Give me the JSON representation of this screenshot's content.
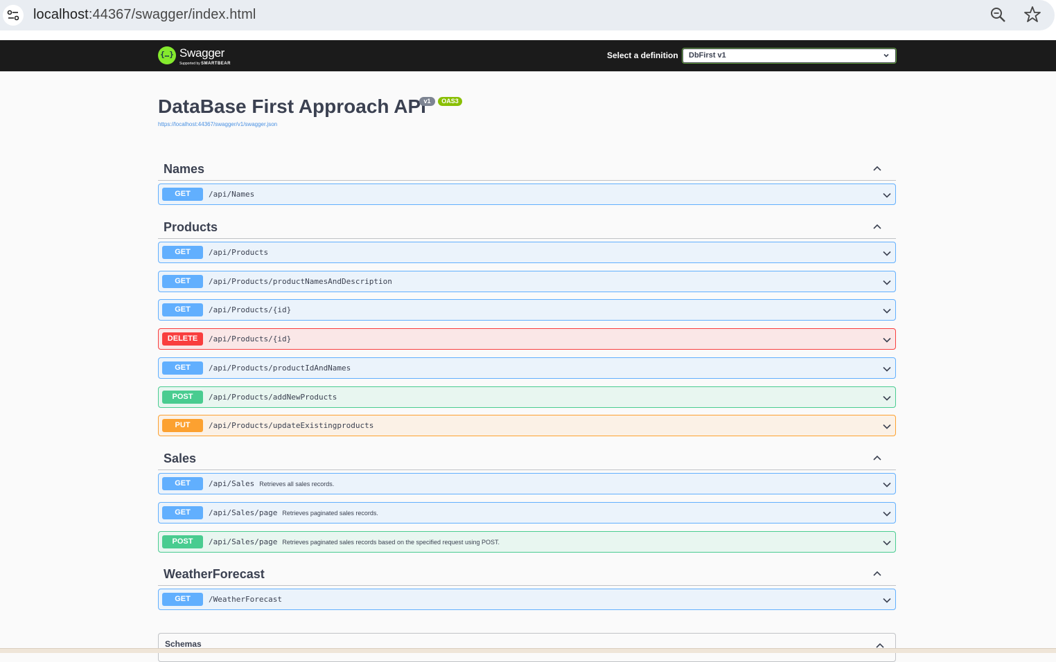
{
  "browser": {
    "url_host": "localhost",
    "url_rest": ":44367/swagger/index.html"
  },
  "topbar": {
    "logo_text": "Swagger",
    "logo_sub_prefix": "Supported by",
    "logo_sub_brand": "SMARTBEAR",
    "definition_label": "Select a definition",
    "definition_value": "DbFirst v1"
  },
  "info": {
    "title": "DataBase First Approach API",
    "version_badge": "v1",
    "oas_badge": "OAS3",
    "spec_url": "https://localhost:44367/swagger/v1/swagger.json"
  },
  "tags": [
    {
      "name": "Names",
      "operations": [
        {
          "method": "GET",
          "path": "/api/Names",
          "summary": ""
        }
      ]
    },
    {
      "name": "Products",
      "operations": [
        {
          "method": "GET",
          "path": "/api/Products",
          "summary": ""
        },
        {
          "method": "GET",
          "path": "/api/Products/productNamesAndDescription",
          "summary": ""
        },
        {
          "method": "GET",
          "path": "/api/Products/{id}",
          "summary": ""
        },
        {
          "method": "DELETE",
          "path": "/api/Products/{id}",
          "summary": ""
        },
        {
          "method": "GET",
          "path": "/api/Products/productIdAndNames",
          "summary": ""
        },
        {
          "method": "POST",
          "path": "/api/Products/addNewProducts",
          "summary": ""
        },
        {
          "method": "PUT",
          "path": "/api/Products/updateExistingproducts",
          "summary": ""
        }
      ]
    },
    {
      "name": "Sales",
      "operations": [
        {
          "method": "GET",
          "path": "/api/Sales",
          "summary": "Retrieves all sales records."
        },
        {
          "method": "GET",
          "path": "/api/Sales/page",
          "summary": "Retrieves paginated sales records."
        },
        {
          "method": "POST",
          "path": "/api/Sales/page",
          "summary": "Retrieves paginated sales records based on the specified request using POST."
        }
      ]
    },
    {
      "name": "WeatherForecast",
      "operations": [
        {
          "method": "GET",
          "path": "/WeatherForecast",
          "summary": ""
        }
      ]
    }
  ],
  "schemas": {
    "label": "Schemas"
  },
  "colors": {
    "get": "#61affe",
    "delete": "#f93e3e",
    "post": "#49cc90",
    "put": "#fca130",
    "topbar": "#1b1b1b",
    "logo": "#85ea2d"
  },
  "icons": [
    "site-info-icon",
    "zoom-icon",
    "star-icon",
    "swagger-logo-icon",
    "chevron-up-icon",
    "chevron-down-icon"
  ]
}
